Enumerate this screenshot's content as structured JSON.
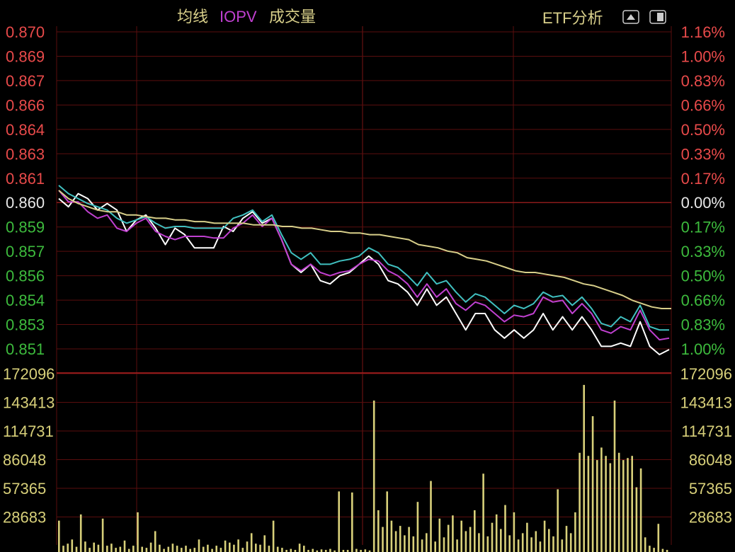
{
  "header": {
    "legend": [
      {
        "label": "均线",
        "color": "#d8cf8a"
      },
      {
        "label": "IOPV",
        "color": "#c040d0"
      },
      {
        "label": "成交量",
        "color": "#d8cf8a"
      }
    ],
    "etf_label": "ETF分析",
    "icons": [
      "collapse-up-icon",
      "panel-toggle-icon"
    ]
  },
  "colors": {
    "up": "#e84a4a",
    "down": "#3dbb3d",
    "neutral": "#e8e8e8",
    "grid": "#5a0e0e",
    "volume": "#d8d07a",
    "price": "#ffffff",
    "iopv": "#c040d0",
    "teal": "#40c0c0",
    "avg": "#d8cf8a"
  },
  "chart_data": [
    {
      "type": "line",
      "pre_close": 0.86,
      "ylim": [
        0.8505,
        0.8705
      ],
      "y_ticks_left": [
        "0.870",
        "0.869",
        "0.867",
        "0.866",
        "0.864",
        "0.863",
        "0.861",
        "0.860",
        "0.859",
        "0.857",
        "0.856",
        "0.854",
        "0.853",
        "0.851"
      ],
      "y_ticks_right": [
        "1.16%",
        "1.00%",
        "0.83%",
        "0.66%",
        "0.50%",
        "0.33%",
        "0.17%",
        "0.00%",
        "0.17%",
        "0.33%",
        "0.50%",
        "0.66%",
        "0.83%",
        "1.00%"
      ],
      "series": [
        {
          "key": "price",
          "values": [
            0.86,
            0.8595,
            0.8603,
            0.86,
            0.8593,
            0.8597,
            0.8593,
            0.858,
            0.8587,
            0.859,
            0.8582,
            0.8572,
            0.8582,
            0.8578,
            0.857,
            0.857,
            0.857,
            0.8583,
            0.858,
            0.8588,
            0.8592,
            0.8585,
            0.8588,
            0.8575,
            0.856,
            0.8555,
            0.856,
            0.855,
            0.8548,
            0.8553,
            0.8555,
            0.856,
            0.8565,
            0.856,
            0.855,
            0.8548,
            0.8543,
            0.8535,
            0.8545,
            0.8535,
            0.854,
            0.853,
            0.852,
            0.853,
            0.853,
            0.852,
            0.8515,
            0.852,
            0.8515,
            0.852,
            0.853,
            0.852,
            0.8528,
            0.852,
            0.8528,
            0.852,
            0.851,
            0.851,
            0.8512,
            0.851,
            0.8525,
            0.851,
            0.8505,
            0.8508
          ]
        },
        {
          "key": "iopv",
          "values": [
            0.8605,
            0.8598,
            0.8598,
            0.8592,
            0.8588,
            0.859,
            0.8582,
            0.858,
            0.8585,
            0.8588,
            0.858,
            0.8577,
            0.8575,
            0.8577,
            0.8577,
            0.8577,
            0.8576,
            0.8576,
            0.8582,
            0.8585,
            0.859,
            0.8583,
            0.8588,
            0.8575,
            0.856,
            0.8556,
            0.856,
            0.8555,
            0.8553,
            0.8555,
            0.8556,
            0.856,
            0.8563,
            0.8562,
            0.8556,
            0.8553,
            0.8548,
            0.854,
            0.8548,
            0.854,
            0.8545,
            0.8536,
            0.8532,
            0.8537,
            0.8535,
            0.853,
            0.8525,
            0.8529,
            0.8528,
            0.853,
            0.854,
            0.8537,
            0.8538,
            0.853,
            0.8536,
            0.853,
            0.852,
            0.8518,
            0.8522,
            0.852,
            0.8532,
            0.852,
            0.8514,
            0.8515
          ]
        },
        {
          "key": "teal",
          "values": [
            0.8608,
            0.8603,
            0.86,
            0.8597,
            0.8595,
            0.8593,
            0.8588,
            0.8585,
            0.8587,
            0.8589,
            0.8585,
            0.8582,
            0.8583,
            0.8583,
            0.8582,
            0.8582,
            0.8582,
            0.8582,
            0.8588,
            0.859,
            0.8593,
            0.8586,
            0.859,
            0.8578,
            0.8567,
            0.8563,
            0.8567,
            0.856,
            0.856,
            0.8562,
            0.8563,
            0.8565,
            0.857,
            0.8567,
            0.856,
            0.8558,
            0.8553,
            0.8547,
            0.8555,
            0.8548,
            0.855,
            0.8543,
            0.8537,
            0.8542,
            0.854,
            0.8535,
            0.853,
            0.8535,
            0.8533,
            0.8536,
            0.8543,
            0.854,
            0.8541,
            0.8535,
            0.854,
            0.8533,
            0.8524,
            0.8522,
            0.8528,
            0.8525,
            0.8535,
            0.8522,
            0.852,
            0.852
          ]
        },
        {
          "key": "avg",
          "values": [
            0.8605,
            0.86,
            0.8597,
            0.8595,
            0.8593,
            0.8592,
            0.8592,
            0.859,
            0.859,
            0.8589,
            0.8588,
            0.8588,
            0.8587,
            0.8587,
            0.8586,
            0.8586,
            0.8585,
            0.8585,
            0.8585,
            0.8585,
            0.8584,
            0.8584,
            0.8584,
            0.8583,
            0.8583,
            0.8582,
            0.8582,
            0.8581,
            0.858,
            0.858,
            0.8579,
            0.8579,
            0.8578,
            0.8578,
            0.8577,
            0.8576,
            0.8575,
            0.8572,
            0.8571,
            0.857,
            0.8568,
            0.8567,
            0.8564,
            0.8563,
            0.8562,
            0.856,
            0.8558,
            0.8556,
            0.8555,
            0.8555,
            0.8554,
            0.8553,
            0.8552,
            0.855,
            0.8548,
            0.8547,
            0.8545,
            0.8543,
            0.8541,
            0.8538,
            0.8536,
            0.8534,
            0.8533,
            0.8533
          ]
        }
      ]
    },
    {
      "type": "bar",
      "ylim": [
        0,
        172096
      ],
      "y_ticks": [
        "172096",
        "143413",
        "114731",
        "86048",
        "57365",
        "28683"
      ],
      "values": [
        30000,
        6000,
        8000,
        12000,
        5000,
        36000,
        10000,
        4000,
        9000,
        7000,
        32000,
        6000,
        8000,
        4000,
        5000,
        11000,
        3000,
        6000,
        38000,
        5000,
        4000,
        9000,
        20000,
        7000,
        3000,
        5000,
        8000,
        6000,
        4000,
        6000,
        3000,
        4000,
        12000,
        5000,
        7000,
        3000,
        6000,
        4000,
        11000,
        9000,
        7000,
        12000,
        4000,
        10000,
        18000,
        8000,
        7000,
        16000,
        6000,
        30000,
        5000,
        4000,
        2000,
        3000,
        2000,
        8000,
        6000,
        2000,
        3000,
        1500,
        2500,
        2000,
        3000,
        1500,
        58000,
        2000,
        2000,
        57000,
        3000,
        2000,
        2500,
        1500,
        145000,
        40000,
        24000,
        58000,
        30000,
        20000,
        25000,
        16000,
        24000,
        15000,
        48000,
        12000,
        18000,
        68000,
        10000,
        32000,
        14000,
        26000,
        35000,
        12000,
        30000,
        20000,
        24000,
        40000,
        18000,
        75000,
        15000,
        28000,
        36000,
        22000,
        45000,
        16000,
        38000,
        12000,
        18000,
        28000,
        14000,
        20000,
        10000,
        30000,
        22000,
        15000,
        60000,
        12000,
        25000,
        18000,
        38000,
        95000,
        160000,
        92000,
        130000,
        88000,
        100000,
        92000,
        85000,
        145000,
        95000,
        88000,
        90000,
        92000,
        62000,
        80000,
        14000,
        6000,
        4000,
        27000,
        3000,
        2000
      ]
    }
  ]
}
